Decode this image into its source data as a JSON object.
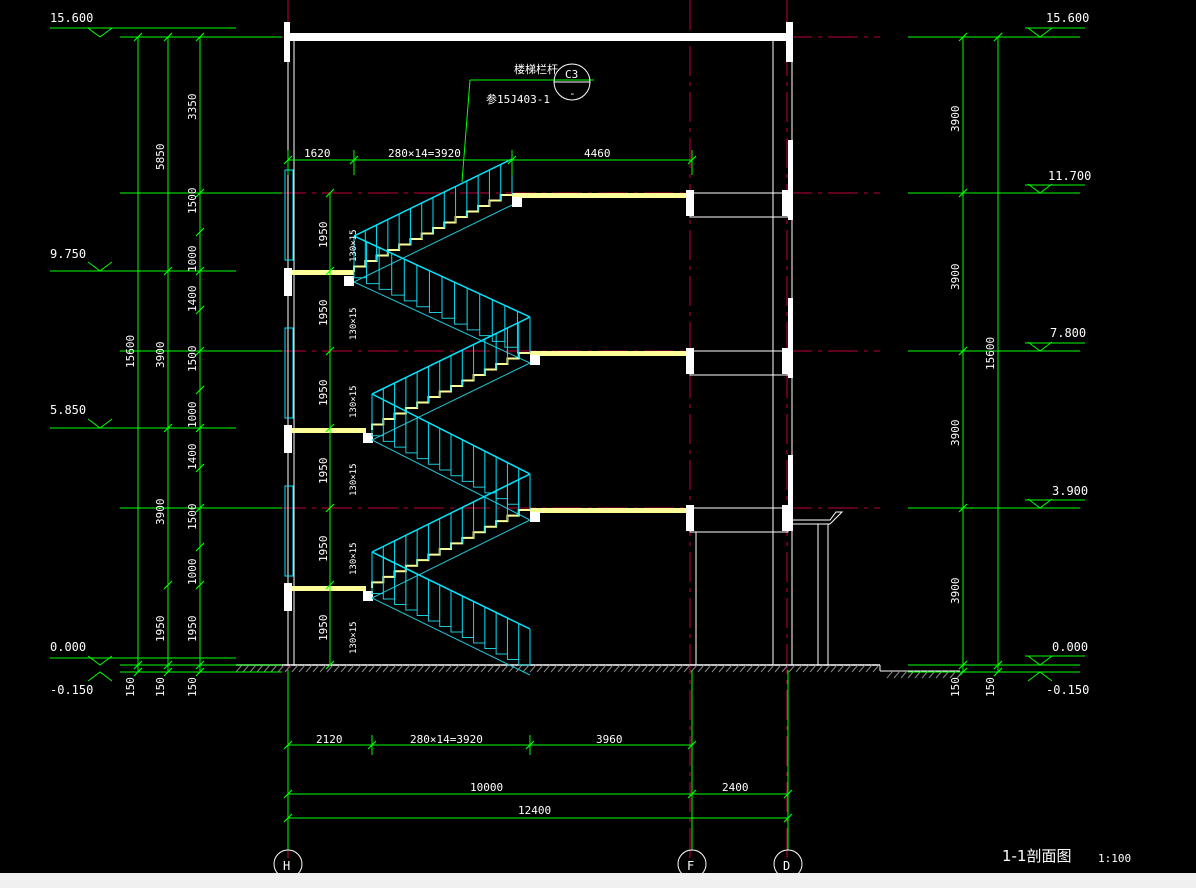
{
  "drawing": {
    "title": "1-1剖面图",
    "scale": "1:100",
    "colors": {
      "background": "#000000",
      "dimension": "#00ff00",
      "wall": "#ffffff",
      "slab_fill": "#ffff66",
      "axis_line": "#c0003a",
      "railing": "#00e5ff",
      "stair": "#1fc8d8"
    }
  },
  "elevations": {
    "left": {
      "e1": "15.600",
      "e2": "9.750",
      "e3": "5.850",
      "e4": "0.000",
      "e5": "-0.150"
    },
    "right": {
      "e1": "15.600",
      "e2": "11.700",
      "e3": "7.800",
      "e4": "3.900",
      "e5": "0.000",
      "e6": "-0.150"
    }
  },
  "left_dims": {
    "overall": "15600",
    "col2": [
      "5850",
      "3900",
      "3900",
      "1950",
      "150"
    ],
    "col3": [
      "3350",
      "1500",
      "1000",
      "1400",
      "1500",
      "1000",
      "1400",
      "1500",
      "1000",
      "1950",
      "150"
    ],
    "col1_bottom": "150"
  },
  "right_dims": {
    "overall": "15600",
    "floors": [
      "3900",
      "3900",
      "3900",
      "3900"
    ],
    "bottom": [
      "150",
      "150"
    ]
  },
  "stair_dims": {
    "landing_height": "1950",
    "riser_label": "130×15"
  },
  "top_dims": {
    "a": "1620",
    "b": "280×14=3920",
    "c": "4460"
  },
  "bottom_dims": {
    "a": "2120",
    "b": "280×14=3920",
    "c": "3960",
    "d": "10000",
    "e": "2400",
    "total": "12400"
  },
  "callout": {
    "label": "楼梯栏杆",
    "ref": "参15J403-1",
    "sheet_top": "C3",
    "sheet_bottom": "-"
  },
  "axes": [
    "H",
    "F",
    "D"
  ]
}
